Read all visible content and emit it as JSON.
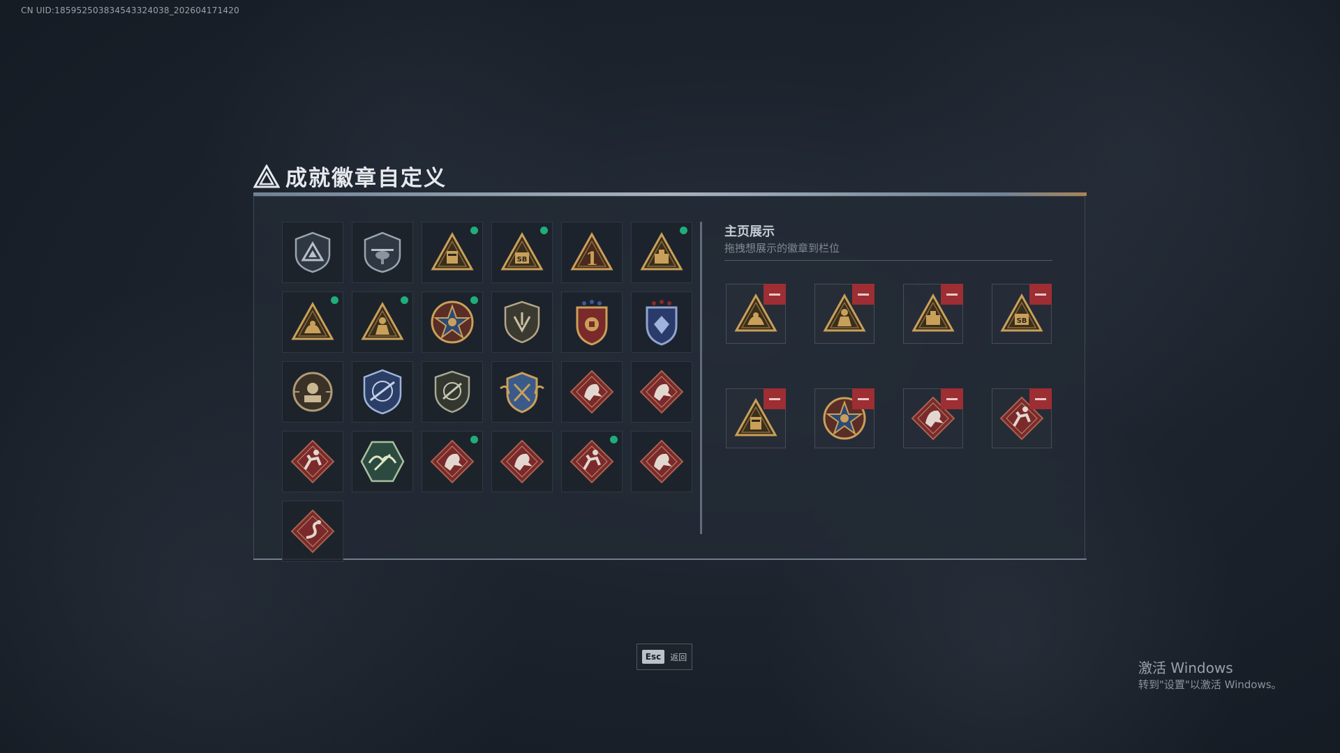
{
  "uid_text": "CN UID:185952503834543324038_202604171420",
  "page": {
    "title": "成就徽章自定义"
  },
  "showcase": {
    "title": "主页展示",
    "hint": "拖拽想展示的徽章到栏位"
  },
  "colors": {
    "accent_green": "#1fae7a",
    "remove_red": "#9d2e33",
    "gold": "#c9a05a",
    "crimson_badge": "#7a2a2a"
  },
  "collection": [
    {
      "icon": "shield-triangle-icon",
      "new": false
    },
    {
      "icon": "helicopter-shield-icon",
      "new": false
    },
    {
      "icon": "triangle-fort-gold-icon",
      "new": true
    },
    {
      "icon": "triangle-sb-gold-icon",
      "new": true
    },
    {
      "icon": "triangle-number-one-icon",
      "new": false
    },
    {
      "icon": "triangle-crate-gold-icon",
      "new": true
    },
    {
      "icon": "triangle-hands-gold-icon",
      "new": true
    },
    {
      "icon": "triangle-soldier-gold-icon",
      "new": true
    },
    {
      "icon": "star-medal-icon",
      "new": true
    },
    {
      "icon": "shield-emblem-icon",
      "new": false
    },
    {
      "icon": "crest-red-gold-icon",
      "new": false
    },
    {
      "icon": "crest-blue-icon",
      "new": false
    },
    {
      "icon": "round-soldier-icon",
      "new": false
    },
    {
      "icon": "blue-rifle-crest-icon",
      "new": false
    },
    {
      "icon": "shield-rifle-icon",
      "new": false
    },
    {
      "icon": "gold-winged-crest-icon",
      "new": false
    },
    {
      "icon": "red-diamond-dragon-icon",
      "new": false
    },
    {
      "icon": "red-diamond-dragon-icon",
      "new": false
    },
    {
      "icon": "red-diamond-runner-icon",
      "new": false
    },
    {
      "icon": "green-hex-wings-icon",
      "new": false
    },
    {
      "icon": "red-diamond-dragon-icon",
      "new": true
    },
    {
      "icon": "red-diamond-dragon-icon",
      "new": false
    },
    {
      "icon": "red-diamond-runner-icon",
      "new": true
    },
    {
      "icon": "red-diamond-dragon-icon",
      "new": false
    },
    {
      "icon": "red-diamond-serpent-icon",
      "new": false
    }
  ],
  "displayed": [
    {
      "icon": "triangle-hands-gold-icon"
    },
    {
      "icon": "triangle-soldier-gold-icon"
    },
    {
      "icon": "triangle-crate-gold-icon"
    },
    {
      "icon": "triangle-sb-gold-icon"
    },
    {
      "icon": "triangle-fort-gold-icon"
    },
    {
      "icon": "star-medal-icon"
    },
    {
      "icon": "red-diamond-dragon-icon"
    },
    {
      "icon": "red-diamond-runner-icon"
    }
  ],
  "esc": {
    "key": "Esc",
    "label": "返回"
  },
  "watermark": {
    "title": "激活 Windows",
    "sub": "转到\"设置\"以激活 Windows。"
  }
}
